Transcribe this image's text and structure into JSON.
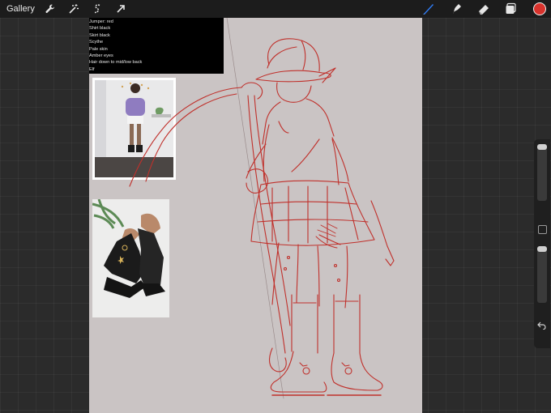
{
  "toolbar": {
    "gallery_label": "Gallery",
    "left_icons": [
      "wrench-icon",
      "magic-wand-icon",
      "selection-icon",
      "transform-arrow-icon"
    ],
    "right_icons": [
      "brush-icon",
      "smudge-icon",
      "eraser-icon",
      "layers-icon"
    ],
    "active_tool": "brush",
    "active_color": "#d8322c"
  },
  "reference_notes": {
    "lines": [
      "Jumper: red",
      "Shirt black",
      "Skirt black",
      "Scythe",
      "Pale skin",
      "Amber eyes",
      "Hair down to mid/low back",
      "Elf"
    ]
  },
  "references": [
    {
      "subject": "outfit reference photo"
    },
    {
      "subject": "black boots reference photo"
    }
  ],
  "sidebar": {
    "controls": [
      "brush-size-slider",
      "modify-button",
      "opacity-slider",
      "undo-button"
    ]
  },
  "colors": {
    "sketch": "#c0302b",
    "canvas": "#cac4c4",
    "accent": "#2f7cf6"
  }
}
